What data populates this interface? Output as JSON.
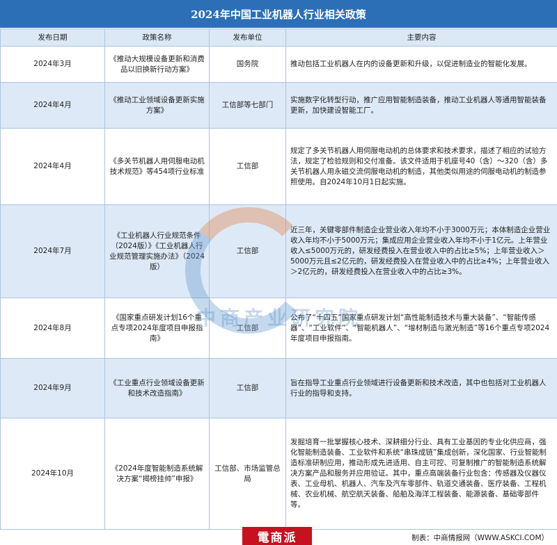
{
  "title": "2024年中国工业机器人行业相关政策",
  "headers": [
    "发布日期",
    "政策名称",
    "发布单位",
    "主要内容"
  ],
  "rows": [
    {
      "date": "2024年3月",
      "name": "《推动大规模设备更新和消费品以旧换新行动方案》",
      "issuer": "国务院",
      "content": "推动包括工业机器人在内的设备更新和升级，以促进制造业的智能化发展。"
    },
    {
      "date": "2024年4月",
      "name": "《推动工业领域设备更新实施方案》",
      "issuer": "工信部等七部门",
      "content": "实施数字化转型行动，推广应用智能制造装备，推动工业机器人等通用智能装备更新，加快建设智能工厂。"
    },
    {
      "date": "2024年4月",
      "name": "《多关节机器人用伺服电动机技术规范》等454项行业标准",
      "issuer": "工信部",
      "content": "规定了多关节机器人用伺服电动机的总体要求和技术要求，描述了相应的试验方法，规定了检验规则和交付准备。该文件适用于机座号40（含）～320（含）多关节机器人用永磁交流伺服电动机的制造，其他类似用途的伺服电动机的制造参照使用。自2024年10月1日起实施。"
    },
    {
      "date": "2024年7月",
      "name": "《工业机器人行业规范条件（2024版）》《工业机器人行业规范管理实施办法》（2024版）",
      "issuer": "工信部",
      "content": "近三年，关键零部件制造企业营业收入年均不小于3000万元；本体制造企业营业收入年均不小于5000万元；集成应用企业营业收入年均不小于1亿元。上年营业收入≤5000万元的，研发经费投入在营业收入中的占比≥5%；上年营业收入＞5000万元且≤2亿元的，研发经费投入在营业收入中的占比≥4%；上年营业收入＞2亿元的，研发经费投入在营业收入中的占比≥3%。"
    },
    {
      "date": "2024年8月",
      "name": "《国家重点研发计划16个重点专项2024年度项目申报指南》",
      "issuer": "工信部",
      "content": "公布了“十四五”国家重点研发计划“高性能制造技术与重大装备”、“智能传感器”、“工业软件”、“智能机器人”、“增材制造与激光制造”等16个重点专项2024年度项目申报指南。"
    },
    {
      "date": "2024年9月",
      "name": "《工业重点行业领域设备更新和技术改造指南》",
      "issuer": "工信部",
      "content": "旨在指导工业重点行业领域进行设备更新和技术改造，其中也包括对工业机器人行业的指导和支持。"
    },
    {
      "date": "2024年10月",
      "name": "《2024年度智能制造系统解决方案“揭榜挂帅”申报》",
      "issuer": "工信部、市场监管总局",
      "content": "发掘培育一批掌握核心技术、深耕细分行业、具有工业基因的专业化供应商，强化智能制造装备、工业软件和系统“串珠成链”集成创新，深化国家、行业智能制造标准研制应用，推动形成先进适用、自主可控、可复制推广的智能制造系统解决方案产品和服务并应用验证。其中，重点高端装备行业包含：传感器及仪器仪表、工业母机、机器人、汽车及汽车零部件、轨道交通装备、医疗装备、工程机械、农业机械、航空航天装备、船舶及海洋工程装备、能源装备、基础零部件等。"
    }
  ],
  "footer": {
    "source": "制表：中商情报网（WWW.ASKCI.COM）",
    "logo": "電商派"
  },
  "watermark": {
    "text": "中商产业研究院"
  }
}
